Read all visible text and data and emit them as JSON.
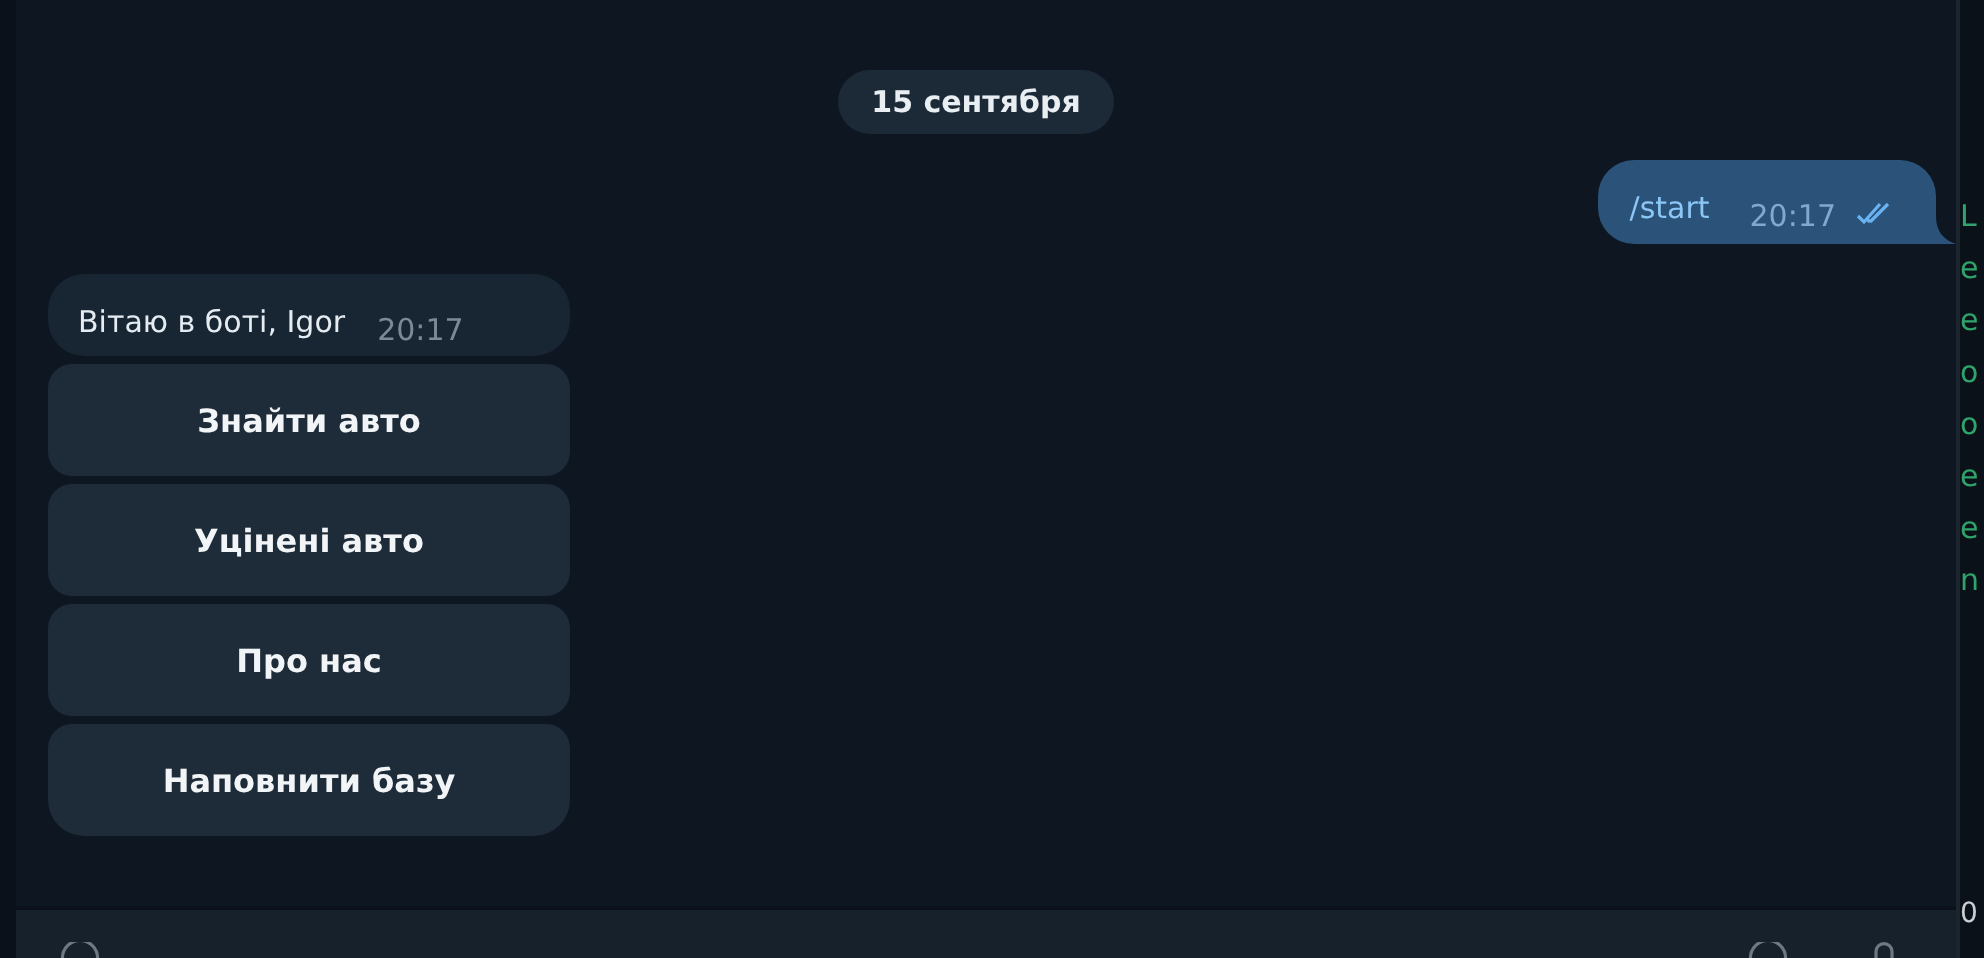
{
  "date_divider": "15 сентября",
  "messages": [
    {
      "kind": "outgoing",
      "text": "/start",
      "time": "20:17",
      "read": true
    },
    {
      "kind": "incoming",
      "text": "Вітаю в боті, Igor",
      "time": "20:17",
      "buttons": [
        {
          "label": "Знайти авто"
        },
        {
          "label": "Уцінені авто"
        },
        {
          "label": "Про нас"
        },
        {
          "label": "Наповнити базу"
        }
      ]
    }
  ],
  "side_panel": {
    "lines": [
      "L",
      "e",
      "e",
      "o",
      "o",
      "e",
      "e",
      "n"
    ],
    "footer": "0"
  }
}
